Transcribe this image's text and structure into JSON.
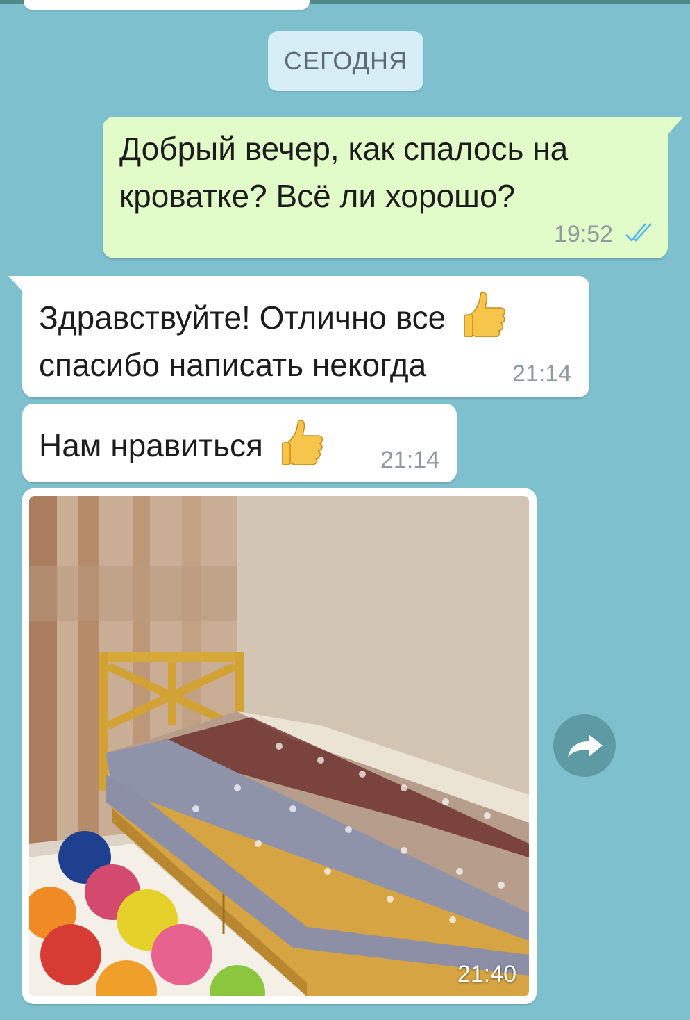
{
  "chat": {
    "date_separator": "СЕГОДНЯ",
    "messages": [
      {
        "direction": "outgoing",
        "lines": [
          "Добрый вечер, как спалось на",
          "кроватке? Всё ли хорошо?"
        ],
        "time": "19:52",
        "status_icon": "double-check-icon"
      },
      {
        "direction": "incoming",
        "lines": [
          "Здравствуйте! Отлично все",
          "спасибо написать некогда"
        ],
        "emoji": "thumbs-up-icon",
        "time": "21:14"
      },
      {
        "direction": "incoming",
        "lines": [
          "Нам нравиться"
        ],
        "emoji": "thumbs-up-icon",
        "time": "21:14"
      },
      {
        "direction": "incoming",
        "type": "photo",
        "image_icon": "bed-photo",
        "time": "21:40"
      }
    ],
    "forward_icon": "share-arrow-icon"
  },
  "colors": {
    "background": "#7fc0cf",
    "outgoing_bubble": "#e2fcc9",
    "incoming_bubble": "#ffffff",
    "date_pill": "#d8eef6",
    "read_ticks": "#4fb6ec"
  }
}
